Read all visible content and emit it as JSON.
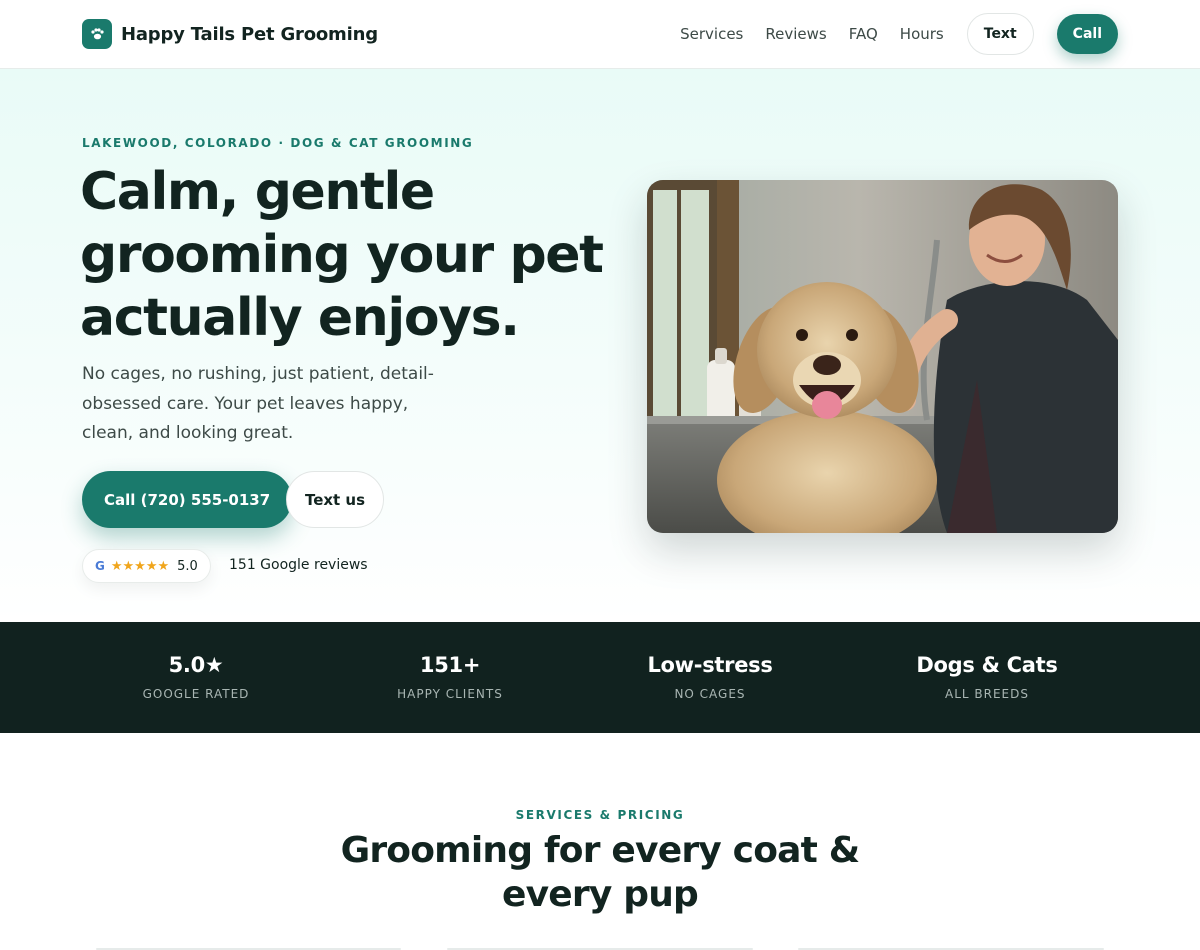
{
  "header": {
    "brand_name": "Happy Tails Pet Grooming",
    "logo_icon": "paw-icon",
    "nav": [
      "Services",
      "Reviews",
      "FAQ",
      "Hours"
    ],
    "text_button": "Text",
    "call_button": "Call"
  },
  "hero": {
    "eyebrow": "LAKEWOOD, COLORADO · DOG & CAT GROOMING",
    "title": "Calm, gentle grooming your pet actually enjoys.",
    "subtitle": "No cages, no rushing, just patient, detail-obsessed care. Your pet leaves happy, clean, and looking great.",
    "call_button": "Call (720) 555-0137",
    "text_button": "Text us",
    "rating": {
      "google_letter": "G",
      "stars": "★★★★★",
      "value": "5.0",
      "review_count": "151 Google reviews"
    },
    "photo_icon": "groomer-with-golden-retriever-photo"
  },
  "stats": [
    {
      "value": "5.0★",
      "label": "GOOGLE RATED"
    },
    {
      "value": "151+",
      "label": "HAPPY CLIENTS"
    },
    {
      "value": "Low-stress",
      "label": "NO CAGES"
    },
    {
      "value": "Dogs & Cats",
      "label": "ALL BREEDS"
    }
  ],
  "services": {
    "eyebrow": "SERVICES & PRICING",
    "title": "Grooming for every coat & every pup"
  },
  "colors": {
    "accent": "#1a7a6c",
    "dark_band": "#11221f",
    "hero_tint": "#e9fbf7",
    "star": "#f0a51c"
  }
}
